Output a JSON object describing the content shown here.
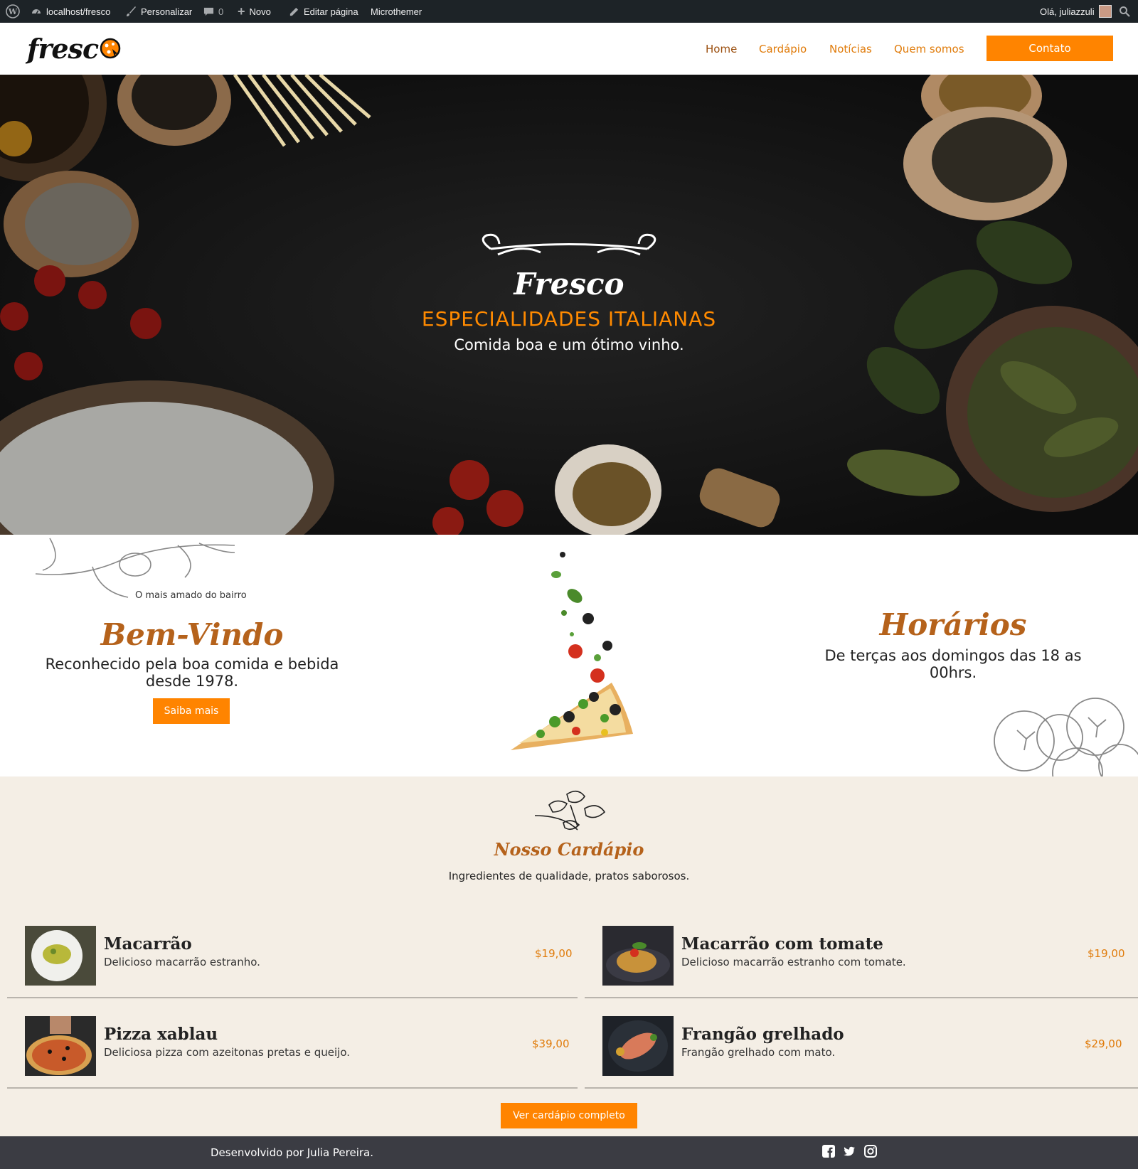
{
  "admin_bar": {
    "site": "localhost/fresco",
    "customize": "Personalizar",
    "comments": "0",
    "new": "Novo",
    "edit": "Editar página",
    "microthemer": "Microthemer",
    "greeting": "Olá, juliazzuli"
  },
  "header": {
    "logo": "fresc",
    "nav": [
      "Home",
      "Cardápio",
      "Notícias",
      "Quem somos"
    ],
    "cta": "Contato"
  },
  "hero": {
    "title": "Fresco",
    "subtitle": "ESPECIALIDADES ITALIANAS",
    "tagline": "Comida boa e um ótimo vinho."
  },
  "welcome": {
    "small": "O mais amado do bairro",
    "title": "Bem-Vindo",
    "desc": "Reconhecido pela boa comida e bebida desde 1978.",
    "button": "Saiba mais"
  },
  "hours": {
    "title": "Horários",
    "desc": "De terças aos domingos das 18 as 00hrs."
  },
  "menu": {
    "title": "Nosso Cardápio",
    "subtitle": "Ingredientes de qualidade, pratos saborosos.",
    "items": [
      {
        "name": "Macarrão",
        "desc": "Delicioso macarrão estranho.",
        "price": "$19,00"
      },
      {
        "name": "Macarrão com tomate",
        "desc": "Delicioso macarrão estranho com tomate.",
        "price": "$19,00"
      },
      {
        "name": "Pizza xablau",
        "desc": "Deliciosa pizza com azeitonas pretas e queijo.",
        "price": "$39,00"
      },
      {
        "name": "Frangão grelhado",
        "desc": "Frangão grelhado com mato.",
        "price": "$29,00"
      }
    ],
    "button": "Ver cardápio completo"
  },
  "footer": {
    "credit": "Desenvolvido por Julia Pereira.",
    "social": [
      "facebook-icon",
      "twitter-icon",
      "instagram-icon"
    ]
  },
  "colors": {
    "accent": "#ff8400",
    "brand": "#b5621b",
    "cream": "#f4eee5",
    "dark": "#1d2327"
  }
}
